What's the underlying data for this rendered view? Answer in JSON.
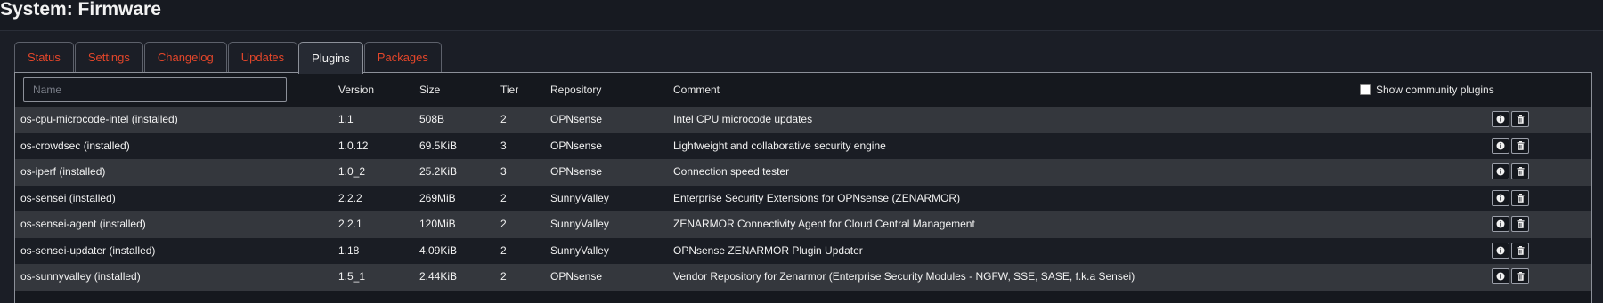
{
  "page": {
    "title": "System: Firmware"
  },
  "tabs": [
    {
      "label": "Status",
      "active": false
    },
    {
      "label": "Settings",
      "active": false
    },
    {
      "label": "Changelog",
      "active": false
    },
    {
      "label": "Updates",
      "active": false
    },
    {
      "label": "Plugins",
      "active": true
    },
    {
      "label": "Packages",
      "active": false
    }
  ],
  "colors": {
    "accent": "#e4462a",
    "row_alt": "#34373d",
    "row_base": "#1a1d24"
  },
  "search": {
    "placeholder": "Name",
    "value": ""
  },
  "columns": {
    "version": "Version",
    "size": "Size",
    "tier": "Tier",
    "repository": "Repository",
    "comment": "Comment"
  },
  "community": {
    "label": "Show community plugins",
    "checked": false
  },
  "icons": {
    "info": "info-icon",
    "delete": "trash-icon"
  },
  "plugins": [
    {
      "name": "os-cpu-microcode-intel (installed)",
      "version": "1.1",
      "size": "508B",
      "tier": "2",
      "repository": "OPNsense",
      "comment": "Intel CPU microcode updates"
    },
    {
      "name": "os-crowdsec (installed)",
      "version": "1.0.12",
      "size": "69.5KiB",
      "tier": "3",
      "repository": "OPNsense",
      "comment": "Lightweight and collaborative security engine"
    },
    {
      "name": "os-iperf (installed)",
      "version": "1.0_2",
      "size": "25.2KiB",
      "tier": "3",
      "repository": "OPNsense",
      "comment": "Connection speed tester"
    },
    {
      "name": "os-sensei (installed)",
      "version": "2.2.2",
      "size": "269MiB",
      "tier": "2",
      "repository": "SunnyValley",
      "comment": "Enterprise Security Extensions for OPNsense (ZENARMOR)"
    },
    {
      "name": "os-sensei-agent (installed)",
      "version": "2.2.1",
      "size": "120MiB",
      "tier": "2",
      "repository": "SunnyValley",
      "comment": "ZENARMOR Connectivity Agent for Cloud Central Management"
    },
    {
      "name": "os-sensei-updater (installed)",
      "version": "1.18",
      "size": "4.09KiB",
      "tier": "2",
      "repository": "SunnyValley",
      "comment": "OPNsense ZENARMOR Plugin Updater"
    },
    {
      "name": "os-sunnyvalley (installed)",
      "version": "1.5_1",
      "size": "2.44KiB",
      "tier": "2",
      "repository": "OPNsense",
      "comment": "Vendor Repository for Zenarmor (Enterprise Security Modules - NGFW, SSE, SASE, f.k.a Sensei)"
    }
  ]
}
